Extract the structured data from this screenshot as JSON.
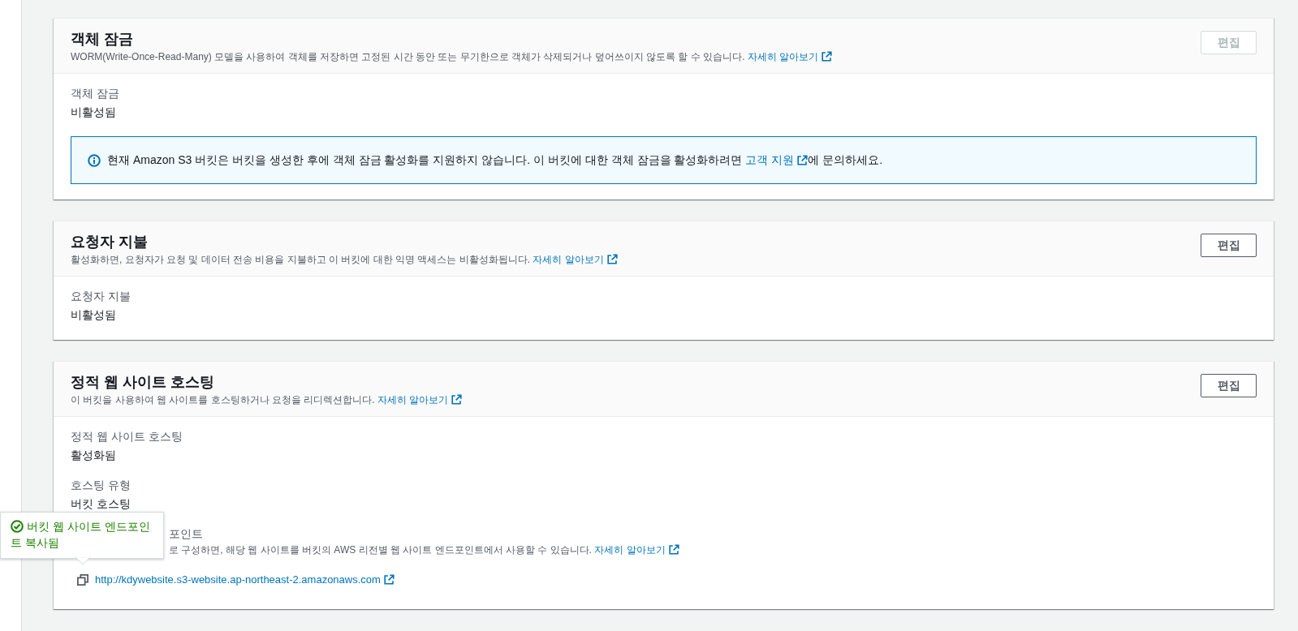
{
  "sections": [
    {
      "title": "객체 잠금",
      "description": "WORM(Write-Once-Read-Many) 모델을 사용하여 객체를 저장하면 고정된 시간 동안 또는 무기한으로 객체가 삭제되거나 덮어쓰이지 않도록 할 수 있습니다.",
      "learn_more": "자세히 알아보기",
      "edit_button": {
        "label": "편집",
        "disabled": true
      },
      "fields": [
        {
          "kind": "text",
          "label": "객체 잠금",
          "value": "비활성됨"
        }
      ],
      "info_alert": {
        "text_before": "현재 Amazon S3 버킷은 버킷을 생성한 후에 객체 잠금 활성화를 지원하지 않습니다. 이 버킷에 대한 객체 잠금을 활성화하려면 ",
        "link": "고객 지원",
        "text_after": "에 문의하세요."
      }
    },
    {
      "title": "요청자 지불",
      "description": "활성화하면, 요청자가 요청 및 데이터 전송 비용을 지불하고 이 버킷에 대한 익명 액세스는 비활성화됩니다.",
      "learn_more": "자세히 알아보기",
      "edit_button": {
        "label": "편집",
        "disabled": false
      },
      "fields": [
        {
          "kind": "text",
          "label": "요청자 지불",
          "value": "비활성됨"
        }
      ]
    },
    {
      "title": "정적 웹 사이트 호스팅",
      "description": "이 버킷을 사용하여 웹 사이트를 호스팅하거나 요청을 리디렉션합니다.",
      "learn_more": "자세히 알아보기",
      "edit_button": {
        "label": "편집",
        "disabled": false
      },
      "fields": [
        {
          "kind": "text",
          "label": "정적 웹 사이트 호스팅",
          "value": "활성화됨"
        },
        {
          "kind": "text",
          "label": "호스팅 유형",
          "value": "버킷 호스팅"
        },
        {
          "kind": "endpoint",
          "label": "포인트",
          "description": "로 구성하면, 해당 웹 사이트를 버킷의 AWS 리전별 웹 사이트 엔드포인트에서 사용할 수 있습니다.",
          "learn_more": "자세히 알아보기",
          "url": "http://kdywebsite.s3-website.ap-northeast-2.amazonaws.com"
        }
      ]
    }
  ],
  "toast": {
    "text": "버킷 웹 사이트 엔드포인트 복사됨"
  }
}
